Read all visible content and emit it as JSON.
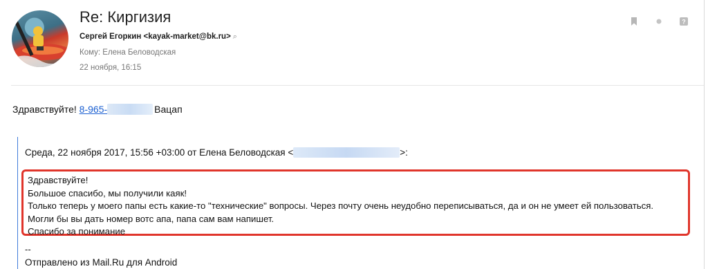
{
  "message": {
    "subject": "Re: Киргизия",
    "sender": "Сергей Егоркин <kayak-market@bk.ru>",
    "to_prefix": "Кому:",
    "to_name": "Елена Беловодская",
    "date": "22 ноября, 16:15"
  },
  "reply": {
    "greeting": "Здравствуйте!",
    "phone_visible": "8-965-",
    "suffix": "Вацап"
  },
  "quote": {
    "header_prefix": "Среда, 22 ноября 2017, 15:56 +03:00 от Елена Беловодская <",
    "header_suffix": ">:",
    "lines": [
      "Здравствуйте!",
      "Большое спасибо, мы получили каяк!",
      "Только теперь у моего папы есть какие-то \"технические\" вопросы. Через почту очень неудобно переписываться, да и он не умеет ей пользоваться.",
      "Могли бы вы дать номер вотс апа, папа сам вам напишет.",
      "Спасибо за понимание"
    ],
    "signature_dash": "--",
    "signature": "Отправлено из Mail.Ru для Android"
  },
  "colors": {
    "highlight_border": "#e0352b",
    "link": "#1a5fd1",
    "quote_bar": "#3f7bd9"
  }
}
